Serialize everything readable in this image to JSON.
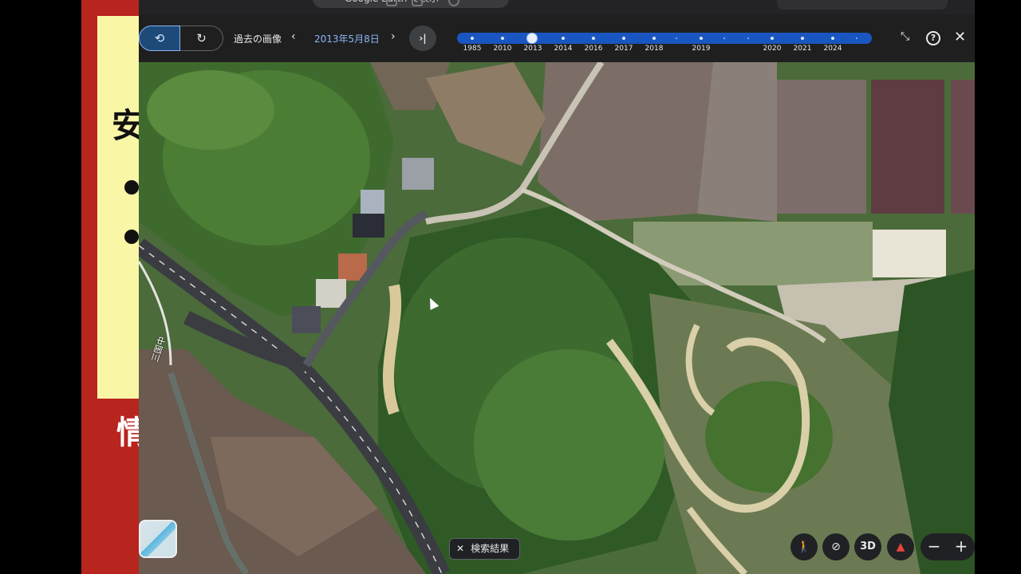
{
  "browser": {
    "omnibox_text": "Google Earth で表示"
  },
  "slide": {
    "char_top": "安",
    "char_bottom": "情"
  },
  "history_bar": {
    "label": "過去の画像",
    "date": "2013年5月8日",
    "prev_symbol": "‹",
    "next_symbol": "›",
    "latest_symbol": "›|",
    "years": [
      "1985",
      "2010",
      "2013",
      "2014",
      "2016",
      "2017",
      "2018",
      "2019",
      "2020",
      "2021",
      "2024"
    ],
    "selected_year": "2013"
  },
  "icons": {
    "history": "history-icon",
    "refresh": "refresh-icon",
    "collapse": "collapse-icon",
    "help": "help-icon",
    "close": "close-icon",
    "pegman": "pegman-icon",
    "tilt": "tilt-icon",
    "compass": "compass-icon"
  },
  "map": {
    "road_label": "三国中",
    "search_results_label": "検索結果",
    "search_close_symbol": "✕",
    "three_d_label": "3D",
    "zoom_out_symbol": "−",
    "zoom_in_symbol": "+"
  },
  "colors": {
    "accent": "#8ab4f8",
    "timeline": "#1a56c2",
    "slide_red": "#b8241e",
    "slide_yellow": "#f9f6a6"
  }
}
